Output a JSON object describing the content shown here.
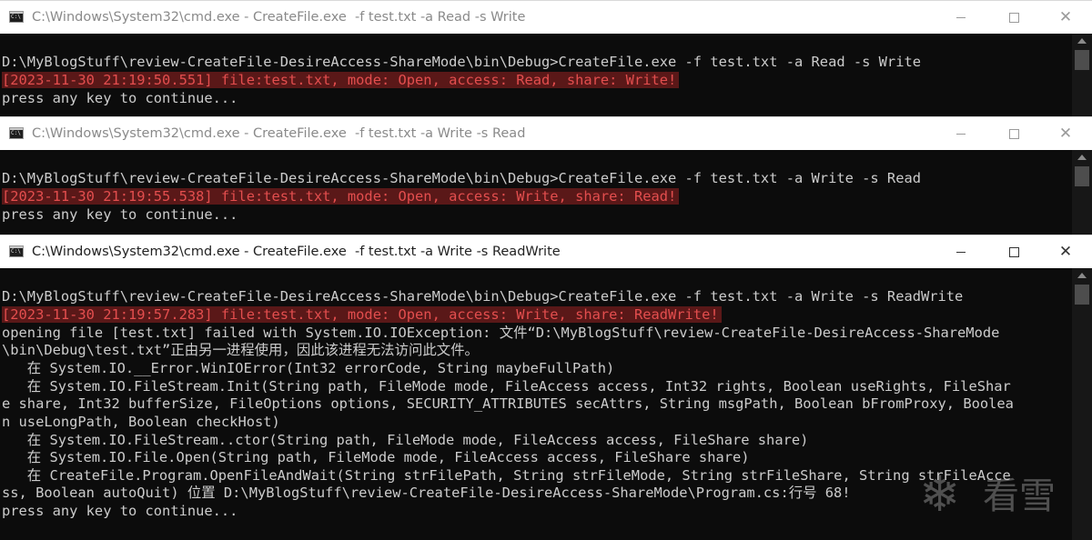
{
  "windows": [
    {
      "title": "C:\\Windows\\System32\\cmd.exe - CreateFile.exe  -f test.txt -a Read -s Write",
      "lines": [
        {
          "text": ""
        },
        {
          "text": "D:\\MyBlogStuff\\review-CreateFile-DesireAccess-ShareMode\\bin\\Debug>CreateFile.exe -f test.txt -a Read -s Write"
        },
        {
          "text": "[2023-11-30 21:19:50.551] file:test.txt, mode: Open, access: Read, share: Write!",
          "highlight": true
        },
        {
          "text": "press any key to continue..."
        }
      ]
    },
    {
      "title": "C:\\Windows\\System32\\cmd.exe - CreateFile.exe  -f test.txt -a Write -s Read",
      "lines": [
        {
          "text": ""
        },
        {
          "text": "D:\\MyBlogStuff\\review-CreateFile-DesireAccess-ShareMode\\bin\\Debug>CreateFile.exe -f test.txt -a Write -s Read"
        },
        {
          "text": "[2023-11-30 21:19:55.538] file:test.txt, mode: Open, access: Write, share: Read!",
          "highlight": true
        },
        {
          "text": "press any key to continue..."
        }
      ]
    },
    {
      "title": "C:\\Windows\\System32\\cmd.exe - CreateFile.exe  -f test.txt -a Write -s ReadWrite",
      "lines": [
        {
          "text": ""
        },
        {
          "text": "D:\\MyBlogStuff\\review-CreateFile-DesireAccess-ShareMode\\bin\\Debug>CreateFile.exe -f test.txt -a Write -s ReadWrite"
        },
        {
          "text": "[2023-11-30 21:19:57.283] file:test.txt, mode: Open, access: Write, share: ReadWrite!",
          "highlight": true
        },
        {
          "text": "opening file [test.txt] failed with System.IO.IOException: 文件“D:\\MyBlogStuff\\review-CreateFile-DesireAccess-ShareMode"
        },
        {
          "text": "\\bin\\Debug\\test.txt”正由另一进程使用，因此该进程无法访问此文件。"
        },
        {
          "text": "   在 System.IO.__Error.WinIOError(Int32 errorCode, String maybeFullPath)"
        },
        {
          "text": "   在 System.IO.FileStream.Init(String path, FileMode mode, FileAccess access, Int32 rights, Boolean useRights, FileShar"
        },
        {
          "text": "e share, Int32 bufferSize, FileOptions options, SECURITY_ATTRIBUTES secAttrs, String msgPath, Boolean bFromProxy, Boolea"
        },
        {
          "text": "n useLongPath, Boolean checkHost)"
        },
        {
          "text": "   在 System.IO.FileStream..ctor(String path, FileMode mode, FileAccess access, FileShare share)"
        },
        {
          "text": "   在 System.IO.File.Open(String path, FileMode mode, FileAccess access, FileShare share)"
        },
        {
          "text": "   在 CreateFile.Program.OpenFileAndWait(String strFilePath, String strFileMode, String strFileShare, String strFileAcce"
        },
        {
          "text": "ss, Boolean autoQuit) 位置 D:\\MyBlogStuff\\review-CreateFile-DesireAccess-ShareMode\\Program.cs:行号 68!"
        },
        {
          "text": "press any key to continue..."
        }
      ]
    }
  ],
  "controls": {
    "minimize": "minimize-icon",
    "maximize": "maximize-icon",
    "close_glyph": "✕"
  },
  "watermark": {
    "text": "看雪"
  },
  "colors": {
    "console_bg": "#0c0c0c",
    "console_fg": "#cccccc",
    "highlight_bg": "#5a1818",
    "highlight_fg": "#e34e4e"
  }
}
